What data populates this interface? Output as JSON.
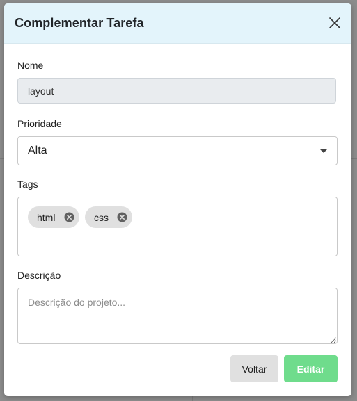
{
  "modal": {
    "title": "Complementar Tarefa"
  },
  "fields": {
    "name_label": "Nome",
    "name_value": "layout",
    "priority_label": "Prioridade",
    "priority_value": "Alta",
    "tags_label": "Tags",
    "tags": [
      "html",
      "css"
    ],
    "description_label": "Descrição",
    "description_placeholder": "Descrição do projeto..."
  },
  "buttons": {
    "back_label": "Voltar",
    "edit_label": "Editar"
  },
  "colors": {
    "header_bg": "#e3f4fb",
    "disabled_input_bg": "#e9ecef",
    "edit_button_bg": "#6fdc8c",
    "chip_bg": "#e0e0e0"
  },
  "icons": {
    "close": "close-icon",
    "chip_delete": "cancel-circle-icon",
    "select_arrow": "caret-down-icon"
  }
}
